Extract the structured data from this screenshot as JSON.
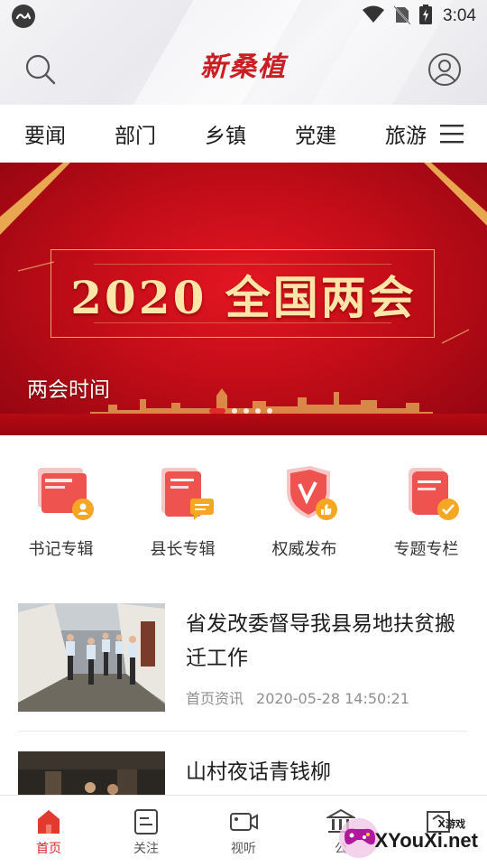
{
  "status_bar": {
    "time": "3:04"
  },
  "header": {
    "logo_text": "新桑植"
  },
  "nav": {
    "tabs": [
      "要闻",
      "部门",
      "乡镇",
      "党建",
      "旅游"
    ]
  },
  "banner": {
    "title": "2020 全国两会",
    "caption": "两会时间",
    "slide_count": 5,
    "active_slide": 1
  },
  "quick_links": [
    {
      "label": "书记专辑",
      "icon": "profile-album-icon"
    },
    {
      "label": "县长专辑",
      "icon": "chat-album-icon"
    },
    {
      "label": "权威发布",
      "icon": "thumbs-up-shield-icon"
    },
    {
      "label": "专题专栏",
      "icon": "checked-scroll-icon"
    }
  ],
  "news": [
    {
      "title": "省发改委督导我县易地扶贫搬迁工作",
      "source": "首页资讯",
      "time": "2020-05-28 14:50:21"
    },
    {
      "title": "山村夜话青钱柳"
    }
  ],
  "tabbar": {
    "items": [
      {
        "label": "首页",
        "icon": "home-icon",
        "active": true
      },
      {
        "label": "关注",
        "icon": "note-icon",
        "active": false
      },
      {
        "label": "视听",
        "icon": "video-icon",
        "active": false
      },
      {
        "label": "公",
        "icon": "bank-icon",
        "active": false
      },
      {
        "label": "",
        "icon": "frame-icon",
        "active": false
      }
    ]
  },
  "watermark": {
    "text": "XYouXi.net",
    "small": "X游戏"
  },
  "colors": {
    "accent": "#d7262b",
    "banner_red": "#c30d18",
    "gold": "#ffe5a8"
  }
}
